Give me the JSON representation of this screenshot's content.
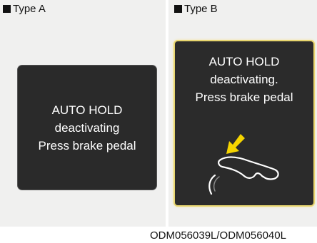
{
  "type_a": {
    "label": "Type A",
    "display_lines": [
      "AUTO HOLD",
      "deactivating",
      "Press brake pedal"
    ]
  },
  "type_b": {
    "label": "Type B",
    "display_lines": [
      "AUTO HOLD",
      "deactivating.",
      "Press brake pedal"
    ],
    "icon": "brake-pedal-icon",
    "arrow_color": "#f5d400"
  },
  "caption": "ODM056039L/ODM056040L",
  "colors": {
    "screen_bg": "#2a2a2a",
    "highlight_border": "#e8d66f",
    "panel_bg": "#f0f0ef"
  }
}
